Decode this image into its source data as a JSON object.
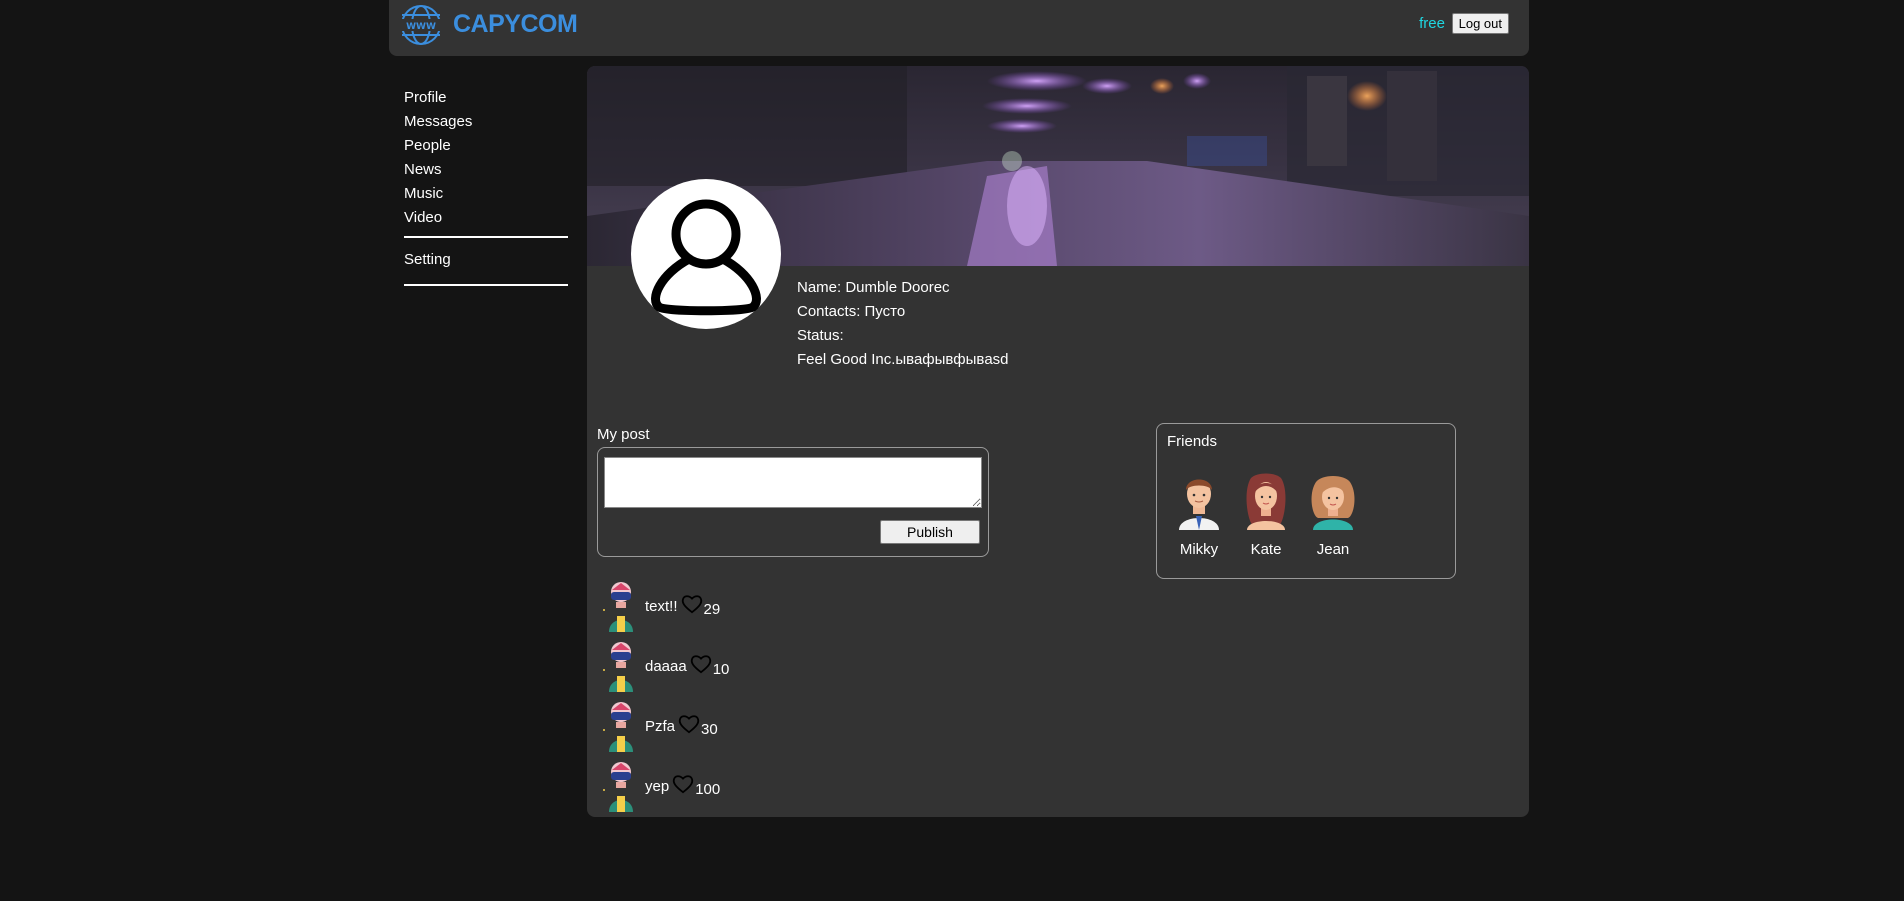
{
  "header": {
    "logo_text": "CAPYCOM",
    "login_status": "free",
    "logout_label": "Log out"
  },
  "nav": {
    "items": [
      {
        "label": "Profile"
      },
      {
        "label": "Messages"
      },
      {
        "label": "People"
      },
      {
        "label": "News"
      },
      {
        "label": "Music"
      },
      {
        "label": "Video"
      }
    ],
    "setting_label": "Setting"
  },
  "profile": {
    "name_line": "Name: Dumble Doorec",
    "contacts_line": "Contacts: Пусто",
    "status_line": "Status:",
    "status_text": "Feel Good Inc.ывафывфывasd"
  },
  "mypost": {
    "title": "My post",
    "textarea_value": "",
    "publish_label": "Publish"
  },
  "posts": [
    {
      "text": "text!!",
      "likes": "29"
    },
    {
      "text": "daaaa",
      "likes": "10"
    },
    {
      "text": "Pzfa",
      "likes": "30"
    },
    {
      "text": "yep",
      "likes": "100"
    }
  ],
  "friends": {
    "title": "Friends",
    "items": [
      {
        "name": "Mikky"
      },
      {
        "name": "Kate"
      },
      {
        "name": "Jean"
      }
    ]
  },
  "colors": {
    "page_bg": "#141414",
    "panel_bg": "#333333",
    "logo_blue": "#3b8ede",
    "status_cyan": "#1fd6e0"
  }
}
